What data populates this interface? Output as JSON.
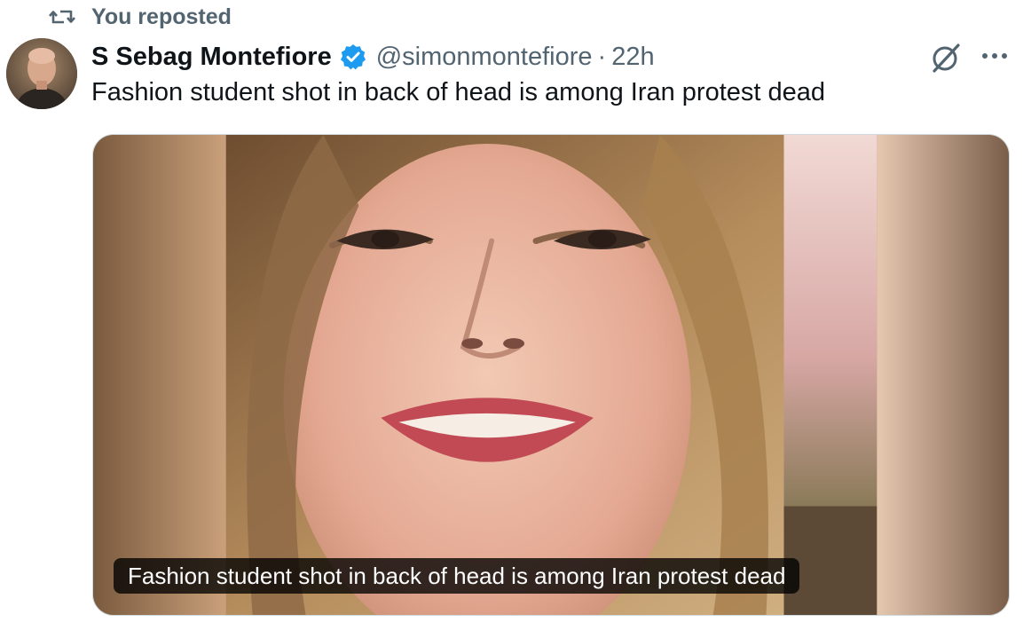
{
  "social_context": {
    "icon": "repost-icon",
    "label": "You reposted"
  },
  "author": {
    "display_name": "S Sebag Montefiore",
    "verified_icon": "verified-badge-icon",
    "verified_color": "#1d9bf0",
    "handle": "@simonmontefiore",
    "separator": "·",
    "time": "22h"
  },
  "actions": {
    "grok_icon": "grok-icon",
    "more_icon": "more-options-icon"
  },
  "tweet": {
    "text": "Fashion student shot in back of head is among Iran protest dead"
  },
  "media": {
    "caption": "Fashion student shot in back of head is among Iran protest dead"
  },
  "colors": {
    "primary_text": "#0f1419",
    "secondary_text": "#536471",
    "border": "#cfd9de"
  }
}
